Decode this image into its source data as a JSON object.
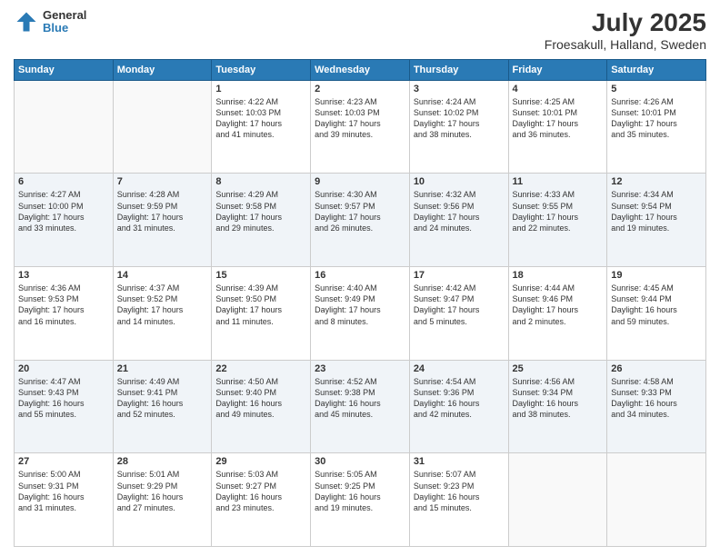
{
  "header": {
    "logo_line1": "General",
    "logo_line2": "Blue",
    "title": "July 2025",
    "subtitle": "Froesakull, Halland, Sweden"
  },
  "days_of_week": [
    "Sunday",
    "Monday",
    "Tuesday",
    "Wednesday",
    "Thursday",
    "Friday",
    "Saturday"
  ],
  "weeks": [
    [
      {
        "day": "",
        "info": ""
      },
      {
        "day": "",
        "info": ""
      },
      {
        "day": "1",
        "info": "Sunrise: 4:22 AM\nSunset: 10:03 PM\nDaylight: 17 hours\nand 41 minutes."
      },
      {
        "day": "2",
        "info": "Sunrise: 4:23 AM\nSunset: 10:03 PM\nDaylight: 17 hours\nand 39 minutes."
      },
      {
        "day": "3",
        "info": "Sunrise: 4:24 AM\nSunset: 10:02 PM\nDaylight: 17 hours\nand 38 minutes."
      },
      {
        "day": "4",
        "info": "Sunrise: 4:25 AM\nSunset: 10:01 PM\nDaylight: 17 hours\nand 36 minutes."
      },
      {
        "day": "5",
        "info": "Sunrise: 4:26 AM\nSunset: 10:01 PM\nDaylight: 17 hours\nand 35 minutes."
      }
    ],
    [
      {
        "day": "6",
        "info": "Sunrise: 4:27 AM\nSunset: 10:00 PM\nDaylight: 17 hours\nand 33 minutes."
      },
      {
        "day": "7",
        "info": "Sunrise: 4:28 AM\nSunset: 9:59 PM\nDaylight: 17 hours\nand 31 minutes."
      },
      {
        "day": "8",
        "info": "Sunrise: 4:29 AM\nSunset: 9:58 PM\nDaylight: 17 hours\nand 29 minutes."
      },
      {
        "day": "9",
        "info": "Sunrise: 4:30 AM\nSunset: 9:57 PM\nDaylight: 17 hours\nand 26 minutes."
      },
      {
        "day": "10",
        "info": "Sunrise: 4:32 AM\nSunset: 9:56 PM\nDaylight: 17 hours\nand 24 minutes."
      },
      {
        "day": "11",
        "info": "Sunrise: 4:33 AM\nSunset: 9:55 PM\nDaylight: 17 hours\nand 22 minutes."
      },
      {
        "day": "12",
        "info": "Sunrise: 4:34 AM\nSunset: 9:54 PM\nDaylight: 17 hours\nand 19 minutes."
      }
    ],
    [
      {
        "day": "13",
        "info": "Sunrise: 4:36 AM\nSunset: 9:53 PM\nDaylight: 17 hours\nand 16 minutes."
      },
      {
        "day": "14",
        "info": "Sunrise: 4:37 AM\nSunset: 9:52 PM\nDaylight: 17 hours\nand 14 minutes."
      },
      {
        "day": "15",
        "info": "Sunrise: 4:39 AM\nSunset: 9:50 PM\nDaylight: 17 hours\nand 11 minutes."
      },
      {
        "day": "16",
        "info": "Sunrise: 4:40 AM\nSunset: 9:49 PM\nDaylight: 17 hours\nand 8 minutes."
      },
      {
        "day": "17",
        "info": "Sunrise: 4:42 AM\nSunset: 9:47 PM\nDaylight: 17 hours\nand 5 minutes."
      },
      {
        "day": "18",
        "info": "Sunrise: 4:44 AM\nSunset: 9:46 PM\nDaylight: 17 hours\nand 2 minutes."
      },
      {
        "day": "19",
        "info": "Sunrise: 4:45 AM\nSunset: 9:44 PM\nDaylight: 16 hours\nand 59 minutes."
      }
    ],
    [
      {
        "day": "20",
        "info": "Sunrise: 4:47 AM\nSunset: 9:43 PM\nDaylight: 16 hours\nand 55 minutes."
      },
      {
        "day": "21",
        "info": "Sunrise: 4:49 AM\nSunset: 9:41 PM\nDaylight: 16 hours\nand 52 minutes."
      },
      {
        "day": "22",
        "info": "Sunrise: 4:50 AM\nSunset: 9:40 PM\nDaylight: 16 hours\nand 49 minutes."
      },
      {
        "day": "23",
        "info": "Sunrise: 4:52 AM\nSunset: 9:38 PM\nDaylight: 16 hours\nand 45 minutes."
      },
      {
        "day": "24",
        "info": "Sunrise: 4:54 AM\nSunset: 9:36 PM\nDaylight: 16 hours\nand 42 minutes."
      },
      {
        "day": "25",
        "info": "Sunrise: 4:56 AM\nSunset: 9:34 PM\nDaylight: 16 hours\nand 38 minutes."
      },
      {
        "day": "26",
        "info": "Sunrise: 4:58 AM\nSunset: 9:33 PM\nDaylight: 16 hours\nand 34 minutes."
      }
    ],
    [
      {
        "day": "27",
        "info": "Sunrise: 5:00 AM\nSunset: 9:31 PM\nDaylight: 16 hours\nand 31 minutes."
      },
      {
        "day": "28",
        "info": "Sunrise: 5:01 AM\nSunset: 9:29 PM\nDaylight: 16 hours\nand 27 minutes."
      },
      {
        "day": "29",
        "info": "Sunrise: 5:03 AM\nSunset: 9:27 PM\nDaylight: 16 hours\nand 23 minutes."
      },
      {
        "day": "30",
        "info": "Sunrise: 5:05 AM\nSunset: 9:25 PM\nDaylight: 16 hours\nand 19 minutes."
      },
      {
        "day": "31",
        "info": "Sunrise: 5:07 AM\nSunset: 9:23 PM\nDaylight: 16 hours\nand 15 minutes."
      },
      {
        "day": "",
        "info": ""
      },
      {
        "day": "",
        "info": ""
      }
    ]
  ]
}
